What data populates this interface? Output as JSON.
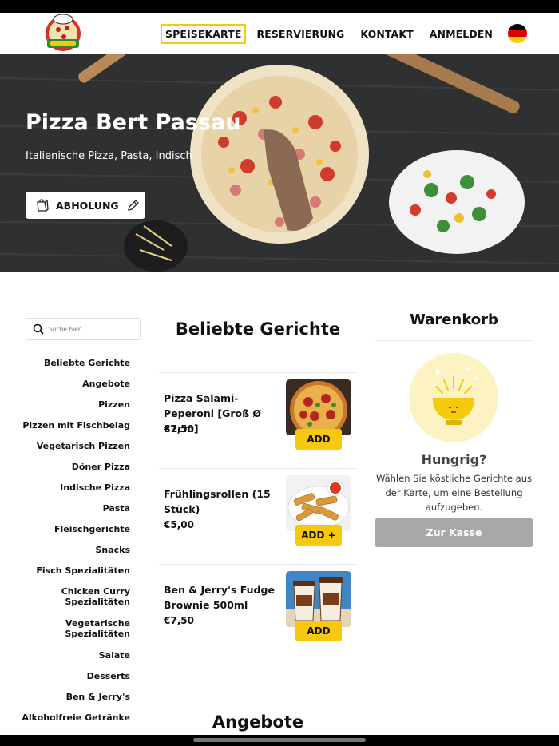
{
  "nav": {
    "links": [
      {
        "label": "SPEISEKARTE",
        "active": true
      },
      {
        "label": "RESERVIERUNG",
        "active": false
      },
      {
        "label": "KONTAKT",
        "active": false
      },
      {
        "label": "ANMELDEN",
        "active": false
      }
    ],
    "flag_colors": [
      "#000000",
      "#dd0000",
      "#ffce00"
    ]
  },
  "hero": {
    "title": "Pizza Bert Passau",
    "subtitle": "Italienische Pizza, Pasta, Indisch",
    "pickup_label": "ABHOLUNG"
  },
  "search": {
    "placeholder": "Suche hier"
  },
  "categories": [
    "Beliebte Gerichte",
    "Angebote",
    "Pizzen",
    "Pizzen mit Fischbelag",
    "Vegetarisch Pizzen",
    "Döner Pizza",
    "Indische Pizza",
    "Pasta",
    "Fleischgerichte",
    "Snacks",
    "Fisch Spezialitäten",
    "Chicken Curry Spezialitäten",
    "Vegetarische Spezialitäten",
    "Salate",
    "Desserts",
    "Ben & Jerry's",
    "Alkoholfreie Getränke"
  ],
  "main": {
    "section_title": "Beliebte Gerichte",
    "dishes": [
      {
        "name": "Pizza Salami-Peperoni [Groß Ø 32cm]",
        "price": "€7,50",
        "button": "ADD"
      },
      {
        "name": "Frühlingsrollen (15 Stück)",
        "price": "€5,00",
        "button": "ADD +"
      },
      {
        "name": "Ben & Jerry's Fudge Brownie 500ml",
        "price": "€7,50",
        "button": "ADD"
      }
    ],
    "next_section_title": "Angebote"
  },
  "cart": {
    "title": "Warenkorb",
    "hungry": "Hungrig?",
    "text": "Wählen Sie köstliche Gerichte aus der Karte, um eine Bestellung aufzugeben.",
    "checkout": "Zur Kasse"
  },
  "colors": {
    "accent": "#f6c90e",
    "checkout_disabled": "#a8a8a8"
  }
}
